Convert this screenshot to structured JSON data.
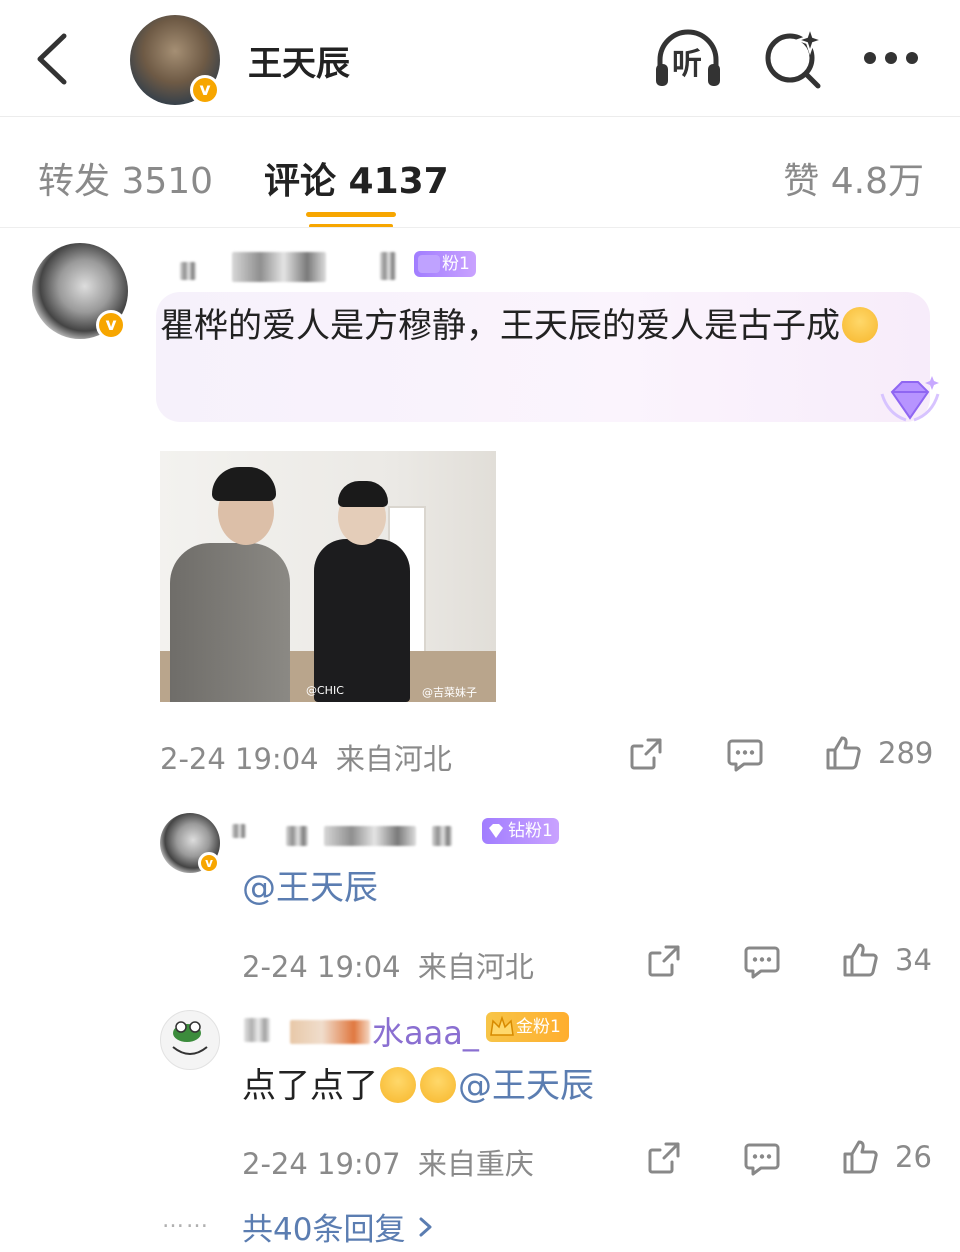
{
  "header": {
    "title": "王天辰",
    "listen_label": "听"
  },
  "tabs": [
    {
      "label": "转发 3510"
    },
    {
      "label": "评论 4137"
    },
    {
      "label": "赞 4.8万"
    }
  ],
  "comments": [
    {
      "badge": "粉1",
      "text": "瞿桦的爱人是方穆静，王天辰的爱人是古子成",
      "image": {
        "watermark_left": "@CHIC",
        "watermark_right": "@吉菜妹子"
      },
      "time": "2-24 19:04",
      "location": "来自河北",
      "likes": "289"
    }
  ],
  "replies": [
    {
      "badge": "钻粉1",
      "mention": "@王天辰",
      "time": "2-24 19:04",
      "location": "来自河北",
      "likes": "34"
    },
    {
      "name_tail": "水aaa_",
      "badge": "金粉1",
      "text": "点了点了",
      "mention": "@王天辰",
      "time": "2-24 19:07",
      "location": "来自重庆",
      "likes": "26"
    }
  ],
  "more_replies": {
    "dots": "……",
    "label": "共40条回复"
  },
  "colors": {
    "accent": "#f7a600",
    "link": "#5b7db1",
    "fan_badge": "#a17dff"
  }
}
